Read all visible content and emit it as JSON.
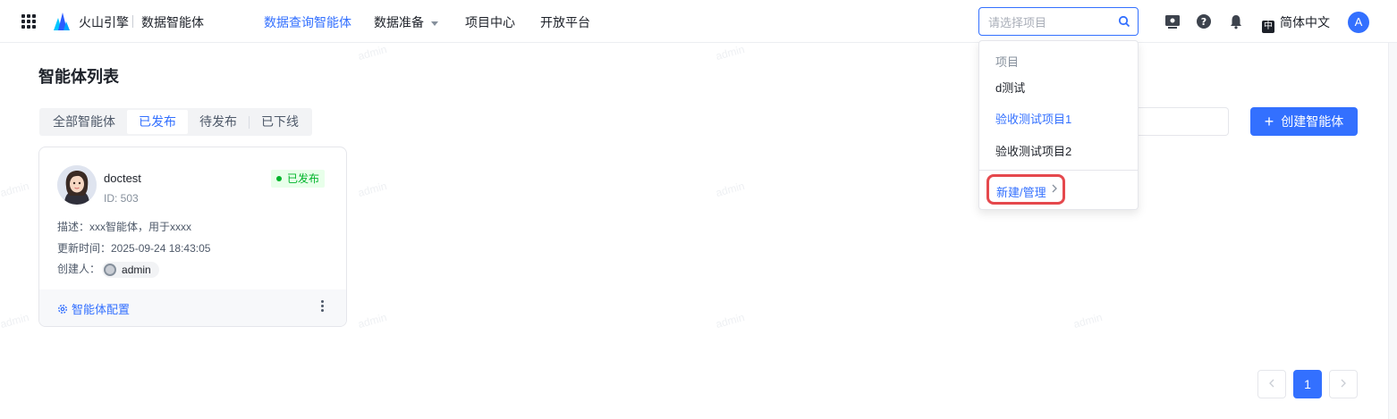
{
  "header": {
    "brand": "火山引擎",
    "product": "数据智能体",
    "nav": [
      {
        "label": "数据查询智能体",
        "active": true
      },
      {
        "label": "数据准备",
        "active": false,
        "has_dropdown": true
      },
      {
        "label": "项目中心",
        "active": false
      },
      {
        "label": "开放平台",
        "active": false
      }
    ],
    "project_search": {
      "placeholder": "请选择项目",
      "value": ""
    },
    "language": {
      "badge": "中",
      "label": "简体中文"
    },
    "user_initial": "A",
    "icons": [
      "apps-grid-icon",
      "screen-record-icon",
      "help-icon",
      "bell-icon"
    ]
  },
  "project_dropdown": {
    "group_label": "项目",
    "items": [
      {
        "label": "d测试",
        "selected": false
      },
      {
        "label": "验收测试项目1",
        "selected": true
      },
      {
        "label": "验收测试项目2",
        "selected": false
      }
    ],
    "manage_label": "新建/管理"
  },
  "main": {
    "title": "智能体列表",
    "tabs": [
      {
        "label": "全部智能体",
        "active": false
      },
      {
        "label": "已发布",
        "active": true
      },
      {
        "label": "待发布",
        "active": false
      },
      {
        "label": "已下线",
        "active": false
      }
    ],
    "create_button": {
      "icon": "+",
      "label": "创建智能体"
    }
  },
  "agents": [
    {
      "name": "doctest",
      "id_text": "ID: 503",
      "status": "已发布",
      "description": "描述：xxx智能体，用于xxxx",
      "updated": "更新时间：2025-09-24 18:43:05",
      "creator_label": "创建人：",
      "creator": "admin",
      "config_label": "智能体配置"
    }
  ],
  "pagination": {
    "current": "1"
  },
  "watermark": "admin",
  "colors": {
    "primary": "#3370ff",
    "success": "#00b42a",
    "highlight": "#e5484d"
  }
}
